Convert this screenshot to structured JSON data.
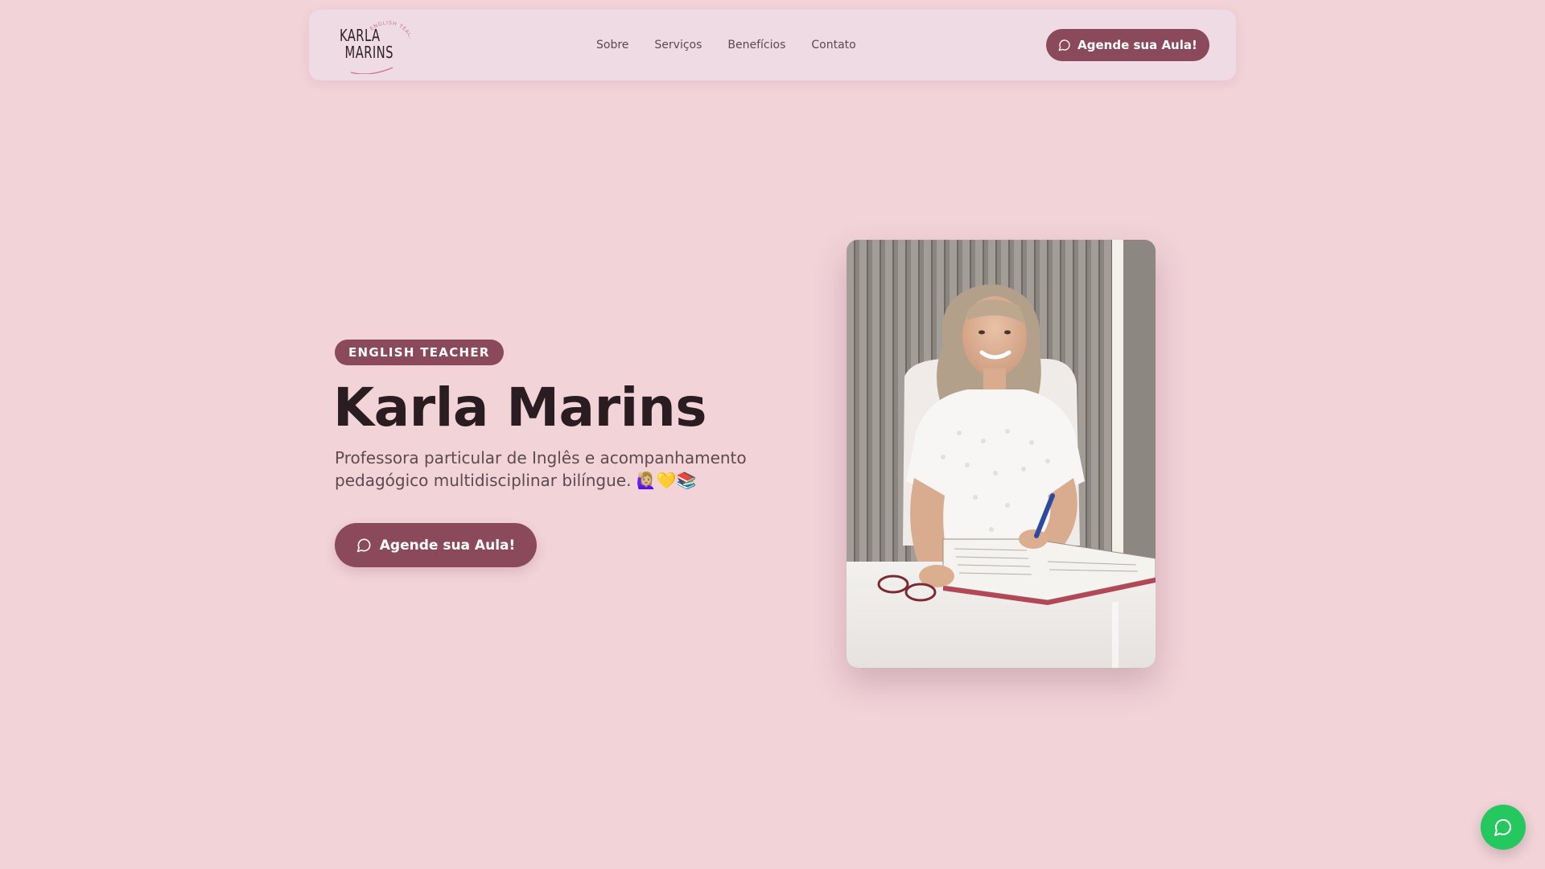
{
  "brand": {
    "logo_line1": "KARLA",
    "logo_line2": "MARINS",
    "logo_tagline": "ENGLISH TEACHER"
  },
  "nav": {
    "links": [
      "Sobre",
      "Serviços",
      "Benefícios",
      "Contato"
    ],
    "cta_label": "Agende sua Aula!",
    "cta_icon": "chat-bubble-icon"
  },
  "hero": {
    "badge": "ENGLISH TEACHER",
    "title": "Karla Marins",
    "subtitle": "Professora particular de Inglês e acompanhamento pedagógico multidisciplinar bilíngue. 🙋🏼‍♀️💛📚",
    "cta_label": "Agende sua Aula!",
    "cta_icon": "chat-bubble-icon",
    "photo": "portrait-photo"
  },
  "floating": {
    "icon": "whatsapp-icon"
  },
  "colors": {
    "background": "#f1d3d8",
    "navbar": "#eedbe3",
    "accent": "#8b4a5c",
    "whatsapp": "#25c75f"
  }
}
